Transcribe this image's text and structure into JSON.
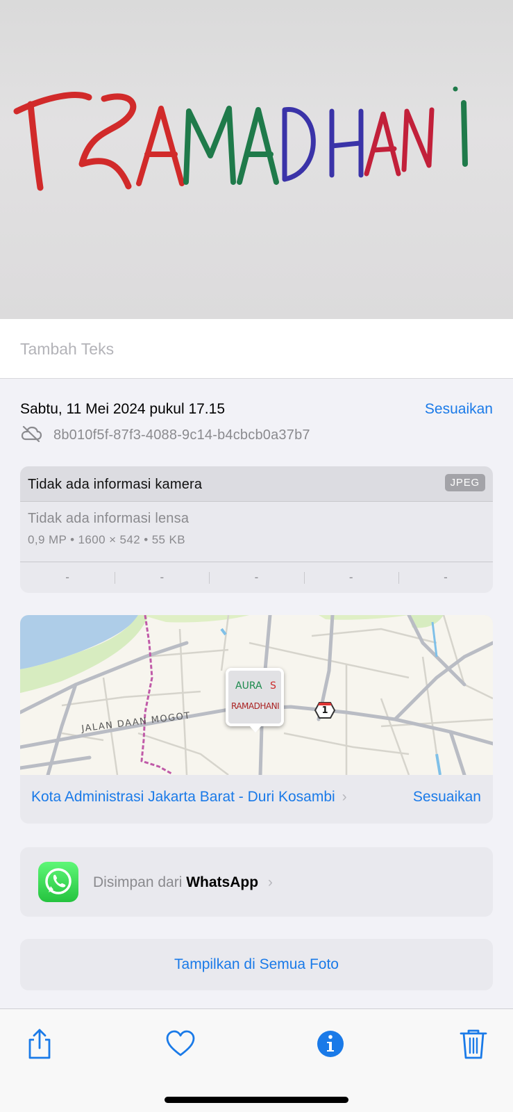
{
  "photo": {
    "handwritten_text": "RAMADHANI",
    "letter_colors": [
      "#d12a2a",
      "#d12a2a",
      "#1f7a4a",
      "#1f7a4a",
      "#1f7a4a",
      "#3a33a8",
      "#3a33a8",
      "#3a33a8",
      "#c2203a",
      "#1f7a4a"
    ]
  },
  "caption": {
    "placeholder": "Tambah Teks"
  },
  "info": {
    "datetime": "Sabtu, 11 Mei 2024 pukul 17.15",
    "adjust_label": "Sesuaikan",
    "identifier": "8b010f5f-87f3-4088-9c14-b4cbcb0a37b7",
    "cloud_icon": "cloud-slash-icon"
  },
  "camera": {
    "title": "Tidak ada informasi kamera",
    "format_badge": "JPEG",
    "lens": "Tidak ada informasi lensa",
    "specs": "0,9 MP  •  1600 × 542  •  55 KB",
    "exif": [
      "-",
      "-",
      "-",
      "-",
      "-"
    ]
  },
  "map": {
    "road_label": "JALAN DAAN MOGOT",
    "route_shield": "1",
    "thumbnail_text_top_left": "AURA",
    "thumbnail_text_top_right": "S",
    "thumbnail_text_bottom": "RAMADHANI",
    "location": "Kota Administrasi Jakarta Barat - Duri Kosambi",
    "location_chevron": "›",
    "adjust_label": "Sesuaikan"
  },
  "source": {
    "prefix": "Disimpan dari",
    "app": "WhatsApp",
    "chevron": "›",
    "app_icon": "whatsapp-icon"
  },
  "show_all": {
    "label": "Tampilkan di Semua Foto"
  },
  "toolbar": {
    "share_icon": "share-icon",
    "favorite_icon": "heart-icon",
    "info_icon": "info-icon",
    "delete_icon": "trash-icon",
    "accent": "#1a7ae8"
  }
}
